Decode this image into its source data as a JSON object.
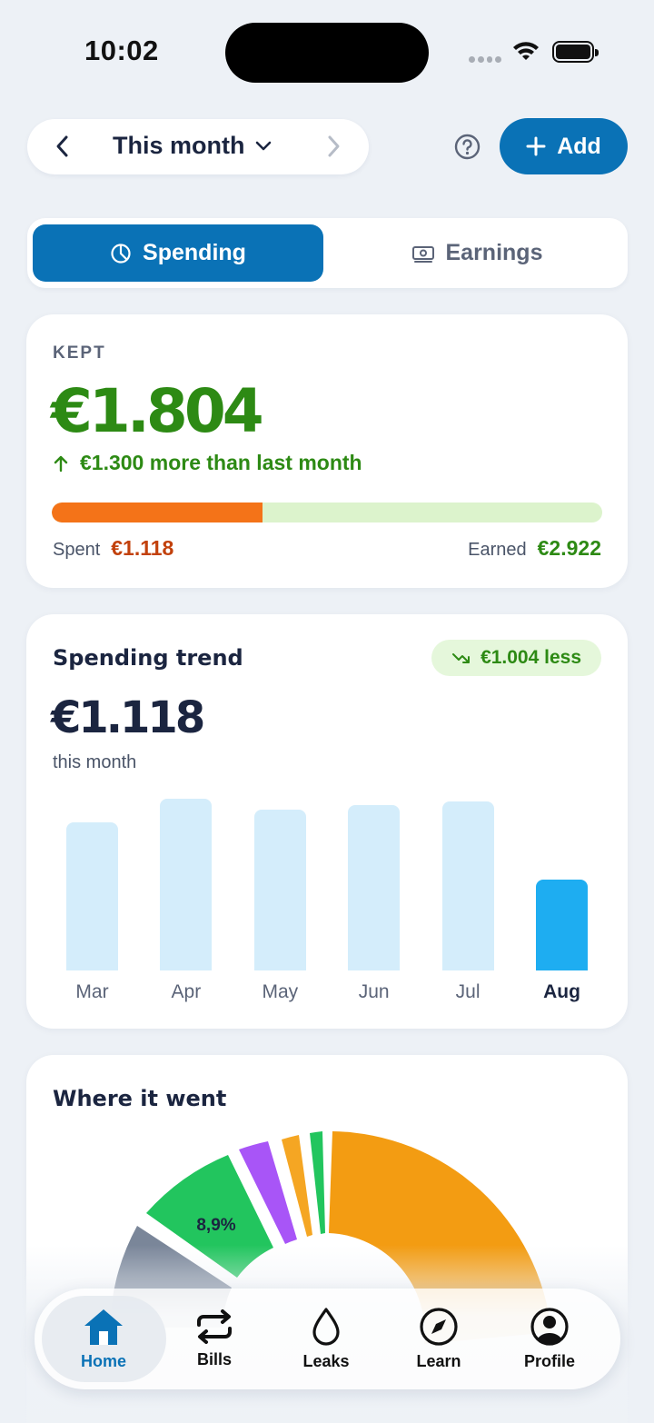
{
  "status_bar": {
    "time": "10:02"
  },
  "header": {
    "period_label": "This month",
    "add_label": "Add"
  },
  "segmented": {
    "spending_label": "Spending",
    "earnings_label": "Earnings",
    "selected": "Spending"
  },
  "kept": {
    "label": "KEPT",
    "amount": "€1.804",
    "delta_text": "€1.300 more than last month",
    "spent_label": "Spent",
    "spent_value": "€1.118",
    "earned_label": "Earned",
    "earned_value": "€2.922",
    "spent_fraction": 0.383,
    "colors": {
      "spent": "#f47318",
      "earned_track": "#dcf3cc",
      "positive": "#2d8a14",
      "spent_text": "#c2410c"
    }
  },
  "trend": {
    "title": "Spending trend",
    "badge": "€1.004 less",
    "amount": "€1.118",
    "subtitle": "this month"
  },
  "chart_data": {
    "type": "bar",
    "categories": [
      "Mar",
      "Apr",
      "May",
      "Jun",
      "Jul",
      "Aug"
    ],
    "values": [
      1.63,
      1.88,
      1.76,
      1.81,
      1.85,
      1.0
    ],
    "highlight": "Aug",
    "title": "Spending trend",
    "xlabel": "",
    "ylabel": "",
    "colors": {
      "bar": "#d4edfb",
      "active": "#1eadf1"
    }
  },
  "where": {
    "title": "Where it went",
    "visible_slice_label": "8,9%"
  },
  "tabbar": {
    "items": [
      {
        "label": "Home",
        "icon": "home-icon"
      },
      {
        "label": "Bills",
        "icon": "repeat-icon"
      },
      {
        "label": "Leaks",
        "icon": "drop-icon"
      },
      {
        "label": "Learn",
        "icon": "compass-icon"
      },
      {
        "label": "Profile",
        "icon": "profile-icon"
      }
    ],
    "active": "Home"
  }
}
